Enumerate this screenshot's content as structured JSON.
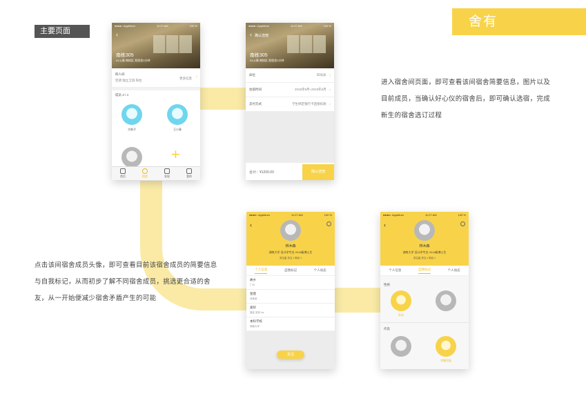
{
  "header": {
    "main_pages_tag": "主要页面",
    "section_title": "舍有"
  },
  "descriptions": {
    "dorm_flow": [
      "进入宿舍间页面，即可查看该间宿舍简要信息，图片以及",
      "目前成员，当确认好心仪的宿舍后，即可确认选宿，完成",
      "新生的宿舍选订过程"
    ],
    "member_flow": [
      "点击该间宿舍成员头像，即可查看目前该宿舍成员的简要信息",
      "与自我标记，从而初步了解不同宿舍成员，挑选更合适的舍",
      "友，从一开始便减少宿舍矛盾产生的可能"
    ]
  },
  "status": {
    "carrier": "●●●●○ Appbitum",
    "time": "11:27 AM",
    "battery": "100 %"
  },
  "phone_dorm": {
    "room_name": "南栋305",
    "address": "A1公寓 南校区 距宿舍2分钟",
    "room_type": "四人间",
    "facilities": "空调 独立卫浴 阳台",
    "more_info": "更多信息",
    "members_title": "成员 3 / 4",
    "members": [
      {
        "name": "大狗子"
      },
      {
        "name": "王小青"
      }
    ],
    "tabs": [
      "首页",
      "宿舍",
      "发现",
      "我的"
    ]
  },
  "phone_confirm": {
    "title": "确认选宿",
    "room_name": "南栋305",
    "address": "A1公寓 南校区 距宿舍2分钟",
    "rows": [
      {
        "label": "床位",
        "value": "四号床"
      },
      {
        "label": "住宿时间",
        "value": "2018年9月~2019年6月"
      },
      {
        "label": "支付方式",
        "value": "学生绑定银行卡直接扣款"
      }
    ],
    "total": "合计：¥1200.00",
    "confirm_button": "确认选宿"
  },
  "phone_profile": {
    "name": "林木森",
    "school": "湖南大学 设计学专业 2018级博士生",
    "stats": "关注量  关注 1  粉丝 1",
    "tabs": [
      "个人信息",
      "自我标记",
      "个人动态"
    ],
    "info": [
      {
        "label": "故乡",
        "value": "广州"
      },
      {
        "label": "星座",
        "value": "双鱼座"
      },
      {
        "label": "爱好",
        "value": "摄影 旅游 ins"
      },
      {
        "label": "本科学校",
        "value": "湖南大学"
      }
    ],
    "follow_button": "关注"
  },
  "phone_marks": {
    "name": "林木森",
    "school": "湖南大学 设计学专业 2018级博士生",
    "stats": "关注量  关注 1  粉丝 1",
    "tabs": [
      "个人信息",
      "自我标记",
      "个人动态"
    ],
    "sections": [
      {
        "title": "性格",
        "badges": [
          {
            "label": "外向",
            "active": true
          },
          {
            "label": "",
            "active": false
          }
        ]
      },
      {
        "title": "作息",
        "badges": [
          {
            "label": "",
            "active": false
          },
          {
            "label": "早睡早起",
            "active": true
          }
        ]
      }
    ]
  }
}
